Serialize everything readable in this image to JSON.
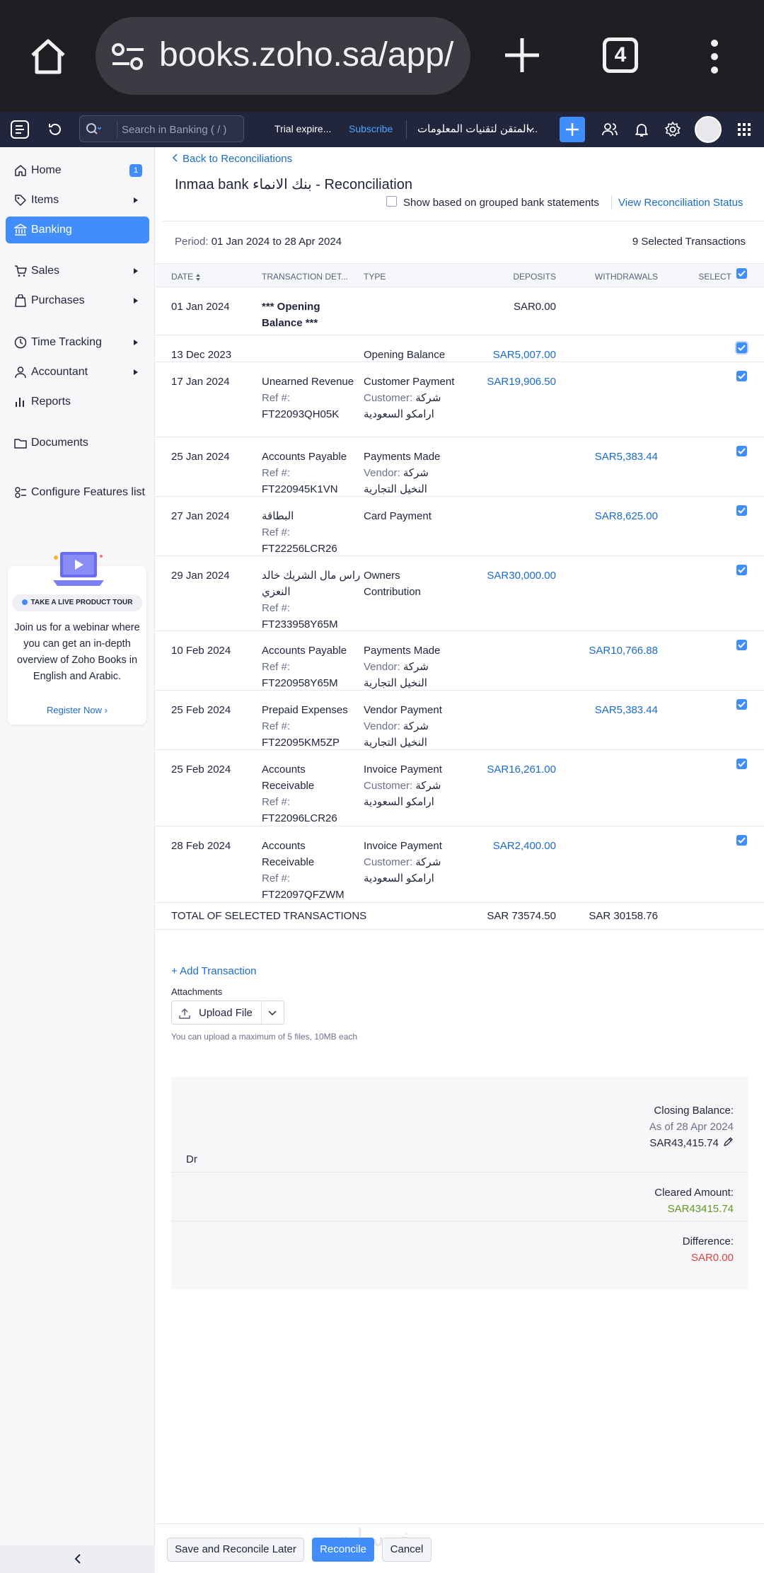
{
  "browser": {
    "url": "books.zoho.sa/app/",
    "tab_count": "4"
  },
  "header": {
    "search_placeholder": "Search in Banking ( / )",
    "trial_text": "Trial expire...",
    "subscribe_label": "Subscribe",
    "org_name": "المتقن لتقنيات المعلومات..."
  },
  "sidebar": {
    "items": [
      {
        "label": "Home",
        "icon": "home-icon",
        "badge": "1"
      },
      {
        "label": "Items",
        "icon": "tag-icon"
      },
      {
        "label": "Banking",
        "icon": "bank-icon",
        "active": true
      },
      {
        "label": "Sales",
        "icon": "cart-icon"
      },
      {
        "label": "Purchases",
        "icon": "bag-icon"
      },
      {
        "label": "Time Tracking",
        "icon": "clock-icon"
      },
      {
        "label": "Accountant",
        "icon": "person-icon"
      },
      {
        "label": "Reports",
        "icon": "chart-icon"
      },
      {
        "label": "Documents",
        "icon": "folder-icon"
      },
      {
        "label": "Configure Features list",
        "icon": "gear-list-icon"
      }
    ],
    "promo": {
      "pill": "TAKE A LIVE PRODUCT TOUR",
      "text": "Join us for a webinar where you can get an in-depth overview of Zoho Books in English and Arabic.",
      "link": "Register Now"
    }
  },
  "main": {
    "back_label": "Back to Reconciliations",
    "title": "Inmaa bank بنك الانماء - Reconciliation",
    "group_label": "Show based on grouped bank statements",
    "view_status_label": "View Reconciliation Status",
    "period_label": "Period:",
    "period_value": "01 Jan 2024 to 28 Apr 2024",
    "selected_count": "9 Selected Transactions",
    "columns": {
      "date": "DATE",
      "details": "TRANSACTION DET...",
      "type": "TYPE",
      "deposits": "DEPOSITS",
      "withdrawals": "WITHDRAWALS",
      "select": "SELECT"
    },
    "rows": [
      {
        "date": "01 Jan 2024",
        "det1": "*** Opening Balance ***",
        "det2": "",
        "det3": "",
        "type1": "",
        "type2": "",
        "type3": "",
        "deposit": "SAR0.00",
        "withdrawal": "",
        "checked": false
      },
      {
        "date": "13 Dec 2023",
        "det1": "",
        "det2": "",
        "det3": "",
        "type1": "Opening Balance",
        "type2": "",
        "type3": "",
        "deposit": "SAR5,007.00",
        "withdrawal": "",
        "checked": true
      },
      {
        "date": "17 Jan 2024",
        "det1": "Unearned Revenue",
        "det2": "Ref #:",
        "det3": "FT22093QH05K",
        "type1": "Customer Payment",
        "type2": "Customer:",
        "type3": "شركة ارامكو السعودية",
        "deposit": "SAR19,906.50",
        "withdrawal": "",
        "checked": true
      },
      {
        "date": "25 Jan 2024",
        "det1": "Accounts Payable",
        "det2": "Ref #:",
        "det3": "FT220945K1VN",
        "type1": "Payments Made",
        "type2": "Vendor:",
        "type3": "شركة النخيل التجارية",
        "deposit": "",
        "withdrawal": "SAR5,383.44",
        "checked": true
      },
      {
        "date": "27 Jan 2024",
        "det1": "البطاقة",
        "det2": "Ref #:",
        "det3": "FT22256LCR26",
        "type1": "Card Payment",
        "type2": "",
        "type3": "",
        "deposit": "",
        "withdrawal": "SAR8,625.00",
        "checked": true
      },
      {
        "date": "29 Jan 2024",
        "det1": "راس مال الشريك خالد النعزي",
        "det2": "Ref #:",
        "det3": "FT233958Y65M",
        "type1": "Owners Contribution",
        "type2": "",
        "type3": "",
        "deposit": "SAR30,000.00",
        "withdrawal": "",
        "checked": true
      },
      {
        "date": "10 Feb 2024",
        "det1": "Accounts Payable",
        "det2": "Ref #:",
        "det3": "FT220958Y65M",
        "type1": "Payments Made",
        "type2": "Vendor:",
        "type3": "شركة النخيل التجارية",
        "deposit": "",
        "withdrawal": "SAR10,766.88",
        "checked": true
      },
      {
        "date": "25 Feb 2024",
        "det1": "Prepaid Expenses",
        "det2": "Ref #:",
        "det3": "FT22095KM5ZP",
        "type1": "Vendor Payment",
        "type2": "Vendor:",
        "type3": "شركة النخيل التجارية",
        "deposit": "",
        "withdrawal": "SAR5,383.44",
        "checked": true
      },
      {
        "date": "25 Feb 2024",
        "det1": "Accounts Receivable",
        "det2": "Ref #:",
        "det3": "FT22096LCR26",
        "type1": "Invoice Payment",
        "type2": "Customer:",
        "type3": "شركة ارامكو السعودية",
        "deposit": "SAR16,261.00",
        "withdrawal": "",
        "checked": true
      },
      {
        "date": "28 Feb 2024",
        "det1": "Accounts Receivable",
        "det2": "Ref #:",
        "det3": "FT22097QFZWM",
        "type1": "Invoice Payment",
        "type2": "Customer:",
        "type3": "شركة ارامكو السعودية",
        "deposit": "SAR2,400.00",
        "withdrawal": "",
        "checked": true
      }
    ],
    "total_label": "TOTAL OF SELECTED TRANSACTIONS",
    "total_deposits": "SAR 73574.50",
    "total_withdrawals": "SAR 30158.76",
    "add_transaction": "+ Add Transaction",
    "attachments_label": "Attachments",
    "upload_label": "Upload File",
    "upload_hint": "You can upload a maximum of 5 files, 10MB each",
    "summary": {
      "dr_label": "Dr",
      "closing_label": "Closing Balance:",
      "closing_asof": "As of 28 Apr 2024",
      "closing_value": "SAR43,415.74",
      "cleared_label": "Cleared Amount:",
      "cleared_value": "SAR43415.74",
      "difference_label": "Difference:",
      "difference_value": "SAR0.00"
    },
    "footer": {
      "save_later": "Save and Reconcile Later",
      "reconcile": "Reconcile",
      "cancel": "Cancel",
      "watermark": "خمسات"
    }
  },
  "colors": {
    "accent": "#408dfb",
    "link": "#1a6cc7",
    "header_bg": "#21263c",
    "success": "#5f9b1f",
    "danger": "#d6453d"
  }
}
